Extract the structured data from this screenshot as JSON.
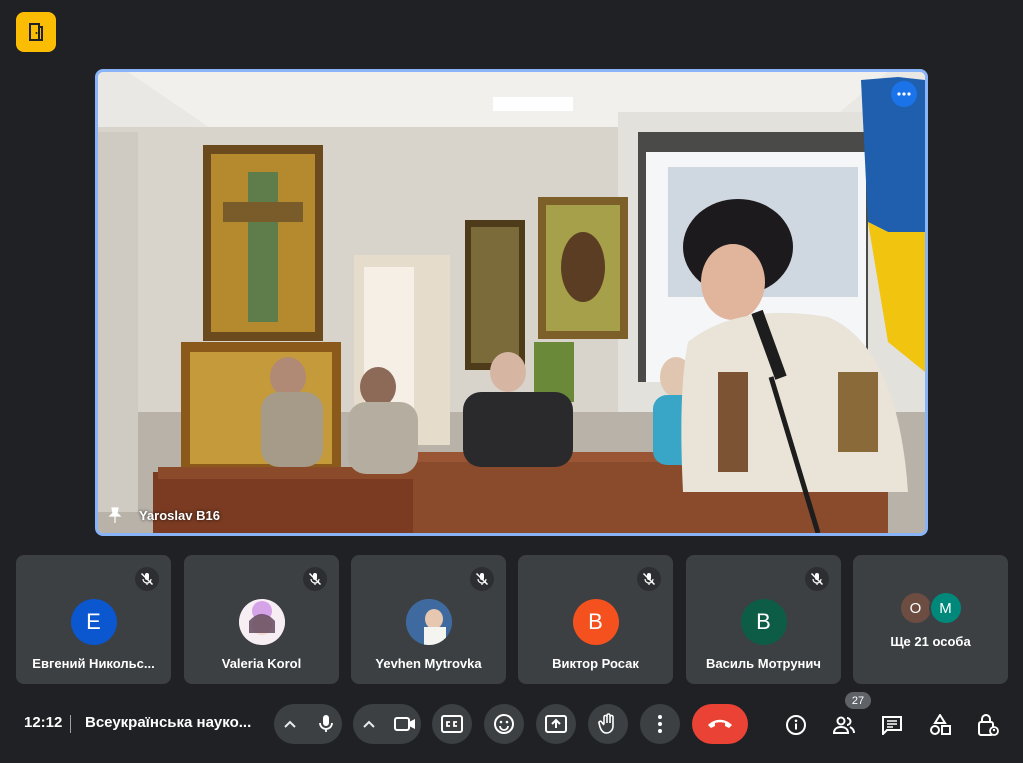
{
  "stage": {
    "speaker_name": "Yaroslav B16"
  },
  "tiles": [
    {
      "name": "Евгений Никольс...",
      "initial": "E",
      "color": "#0b57d0"
    },
    {
      "name": "Valeria Korol",
      "initial": "",
      "color": "#f5e6f0"
    },
    {
      "name": "Yevhen Mytrovka",
      "initial": "",
      "color": "#4a6fa5"
    },
    {
      "name": "Виктор Росак",
      "initial": "В",
      "color": "#f4511e"
    },
    {
      "name": "Василь Мотрунич",
      "initial": "В",
      "color": "#0d5c46"
    }
  ],
  "more": {
    "label": "Ще 21 особа",
    "avatars": [
      {
        "initial": "O",
        "color": "#6d4c41"
      },
      {
        "initial": "M",
        "color": "#00897b"
      }
    ]
  },
  "bottom_bar": {
    "time": "12:12",
    "meeting_title": "Всеукраїнська науко...",
    "people_count": "27"
  },
  "colors": {
    "background": "#202124",
    "tile": "#3c4043",
    "accent_border": "#8ab4f8",
    "hangup": "#ea4335",
    "logo": "#fbbc04"
  }
}
